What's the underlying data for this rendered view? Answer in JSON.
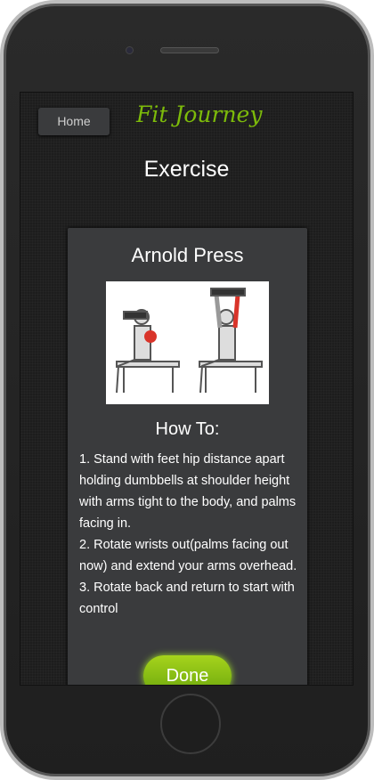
{
  "header": {
    "home_label": "Home",
    "logo": "Fit Journey",
    "title": "Exercise"
  },
  "exercise": {
    "name": "Arnold Press",
    "howto_label": "How To:",
    "steps": [
      "1. Stand with feet hip distance apart holding dumbbells at shoulder height with arms tight to the body, and palms facing in.",
      "2. Rotate wrists out(palms facing out now) and extend your arms overhead.",
      "3. Rotate back and return to start with control"
    ],
    "done_label": "Done"
  },
  "colors": {
    "accent": "#7dbb0a",
    "card": "#3a3b3d",
    "muscle": "#d9342a"
  }
}
